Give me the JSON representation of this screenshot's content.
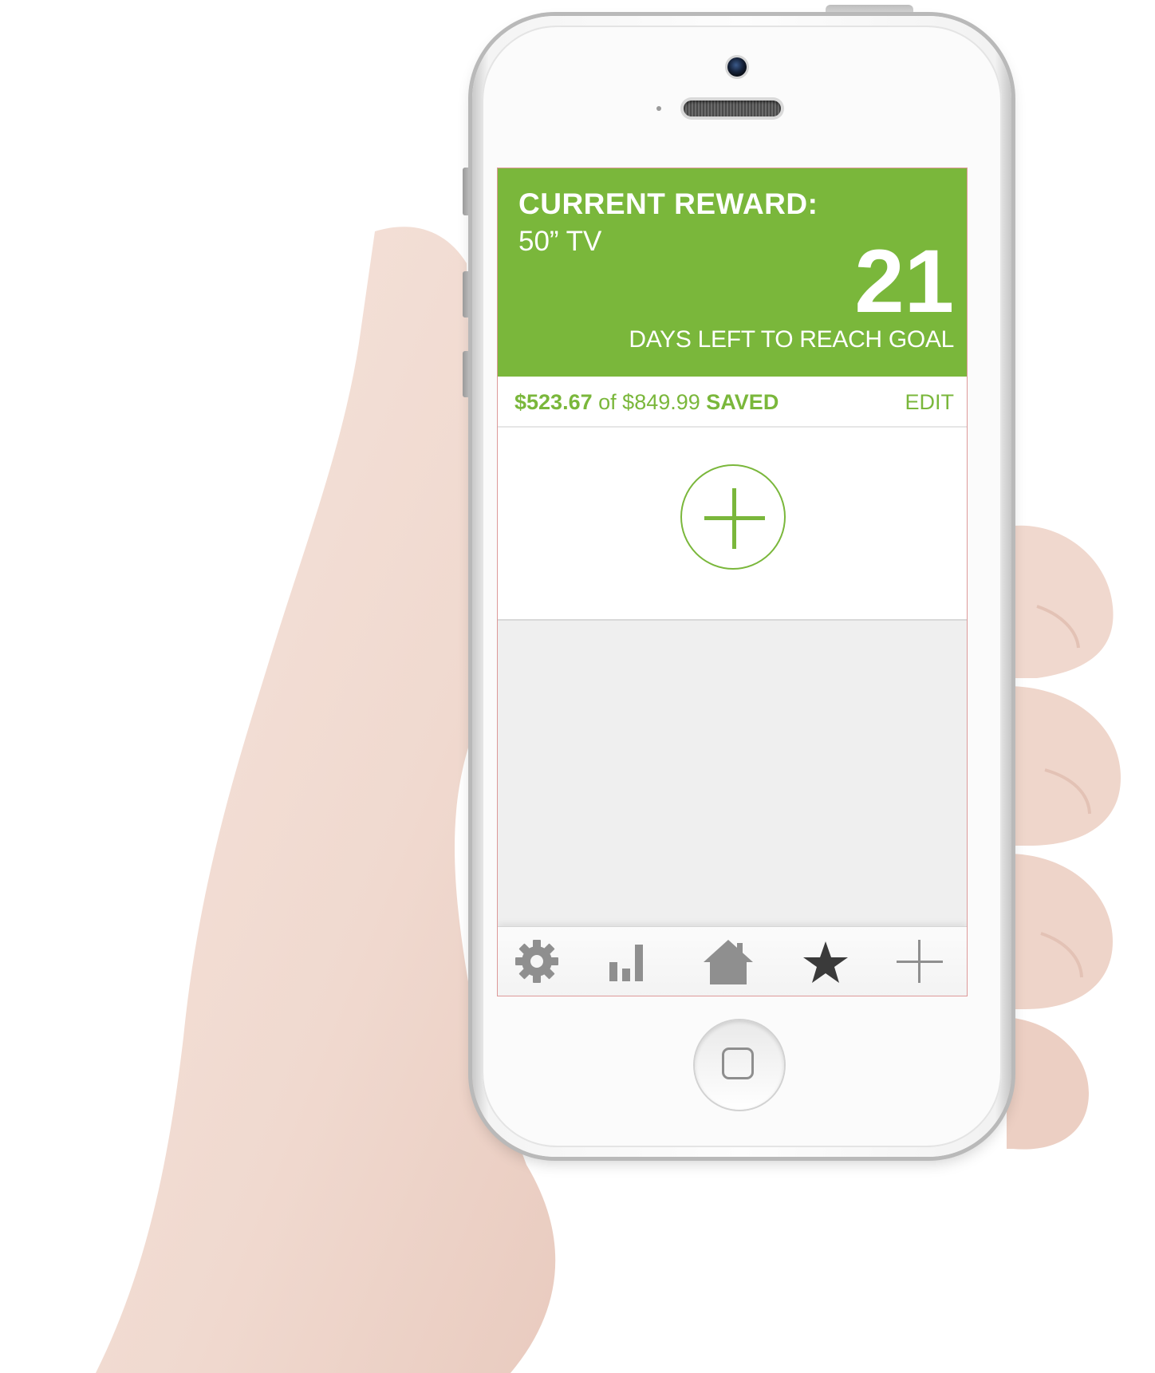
{
  "reward": {
    "title": "CURRENT REWARD:",
    "item": "50” TV",
    "days_left": "21",
    "days_label": "DAYS LEFT TO REACH GOAL"
  },
  "savings": {
    "saved_amount": "$523.67",
    "of_text": "of",
    "goal_amount": "$849.99",
    "saved_label": "SAVED",
    "edit_label": "EDIT"
  },
  "tabs": [
    {
      "icon": "gear-icon"
    },
    {
      "icon": "bar-chart-icon"
    },
    {
      "icon": "home-icon"
    },
    {
      "icon": "star-icon"
    },
    {
      "icon": "plus-icon"
    }
  ],
  "colors": {
    "accent": "#7ab73b",
    "tab_icon": "#8f8f8f",
    "star": "#3a3a3a",
    "screen_bg": "#efefef"
  }
}
